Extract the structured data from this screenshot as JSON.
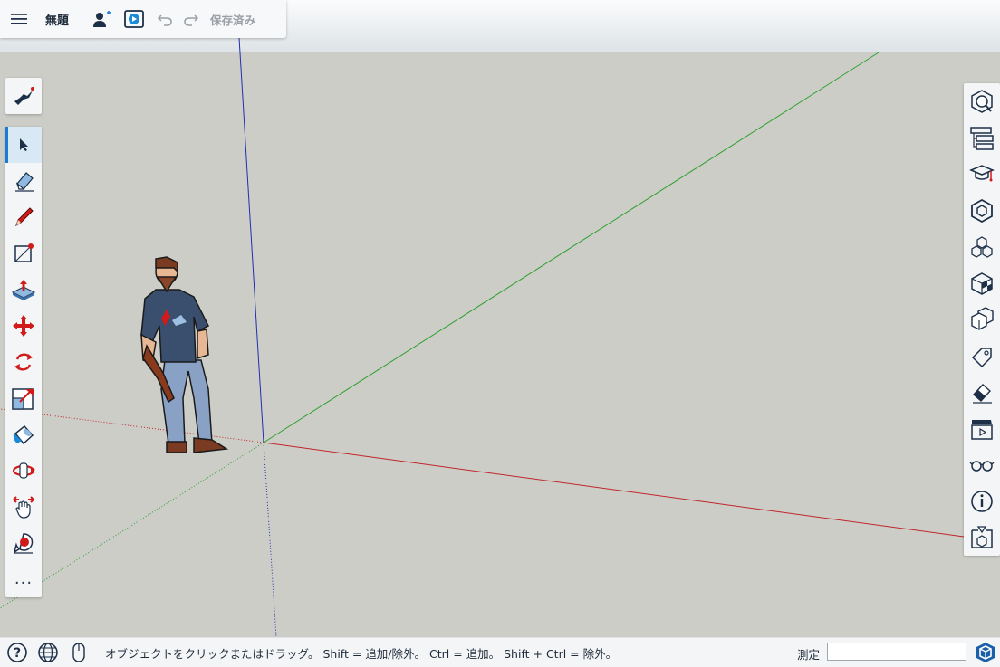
{
  "app": {
    "title": "無題",
    "save_status": "保存済み"
  },
  "topbar": {
    "menu_icon": "hamburger-menu-icon",
    "share_icon": "add-collaborator-icon",
    "present_icon": "play-presentation-icon",
    "undo_icon": "undo-icon",
    "redo_icon": "redo-icon"
  },
  "left_toolbar": {
    "top_tool": "search-warehouse-icon",
    "tools": [
      "select",
      "eraser",
      "line",
      "rectangle",
      "push-pull",
      "move",
      "rotate",
      "offset",
      "paint-bucket",
      "orbit",
      "pan",
      "tape-measure"
    ],
    "more_label": "...",
    "active_tool": "select"
  },
  "right_toolbar": {
    "panels": [
      "model-info",
      "outliner",
      "instructor",
      "components",
      "entity-info-cubes",
      "materials",
      "styles",
      "tags",
      "soften-edges",
      "scenes",
      "display",
      "info",
      "3d-warehouse"
    ]
  },
  "statusbar": {
    "hint": "オブジェクトをクリックまたはドラッグ。 Shift = 追加/除外。 Ctrl = 追加。 Shift + Ctrl = 除外。",
    "measure_label": "測定",
    "measure_value": ""
  },
  "colors": {
    "accent": "#1a7ad4",
    "axis_red": "#c0262a",
    "axis_green": "#2fa12f",
    "axis_blue": "#1f2fb0",
    "ground": "#cdcdc8",
    "sky_top": "#fbfcfd"
  }
}
